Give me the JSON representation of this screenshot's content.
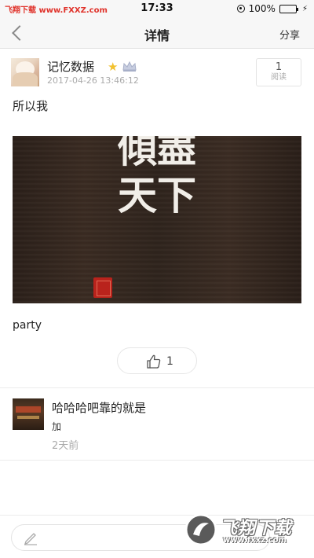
{
  "status_bar": {
    "watermark": "飞翔下载 www.FXXZ.com",
    "time": "17:33",
    "battery": "100%"
  },
  "nav": {
    "title": "详情",
    "share_label": "分享",
    "back_icon": "chevron-left-icon"
  },
  "post": {
    "username": "记忆数据",
    "timestamp": "2017-04-26 13:46:12",
    "read_count": "1",
    "read_label": "阅读",
    "text": "所以我",
    "image_calligraphy": "傾盡天下",
    "caption": "party",
    "like_count": "1",
    "badges": [
      "star-badge-icon",
      "crown-badge-icon"
    ]
  },
  "comments": [
    {
      "title": "哈哈哈吧靠的就是",
      "sub": "加",
      "time": "2天前"
    }
  ],
  "watermark_logo": {
    "text": "飞翔下载",
    "url": "www.fxxz.com"
  },
  "colors": {
    "accent_red": "#e0332b",
    "battery_green": "#35c759",
    "muted_text": "#aaaaaa"
  }
}
